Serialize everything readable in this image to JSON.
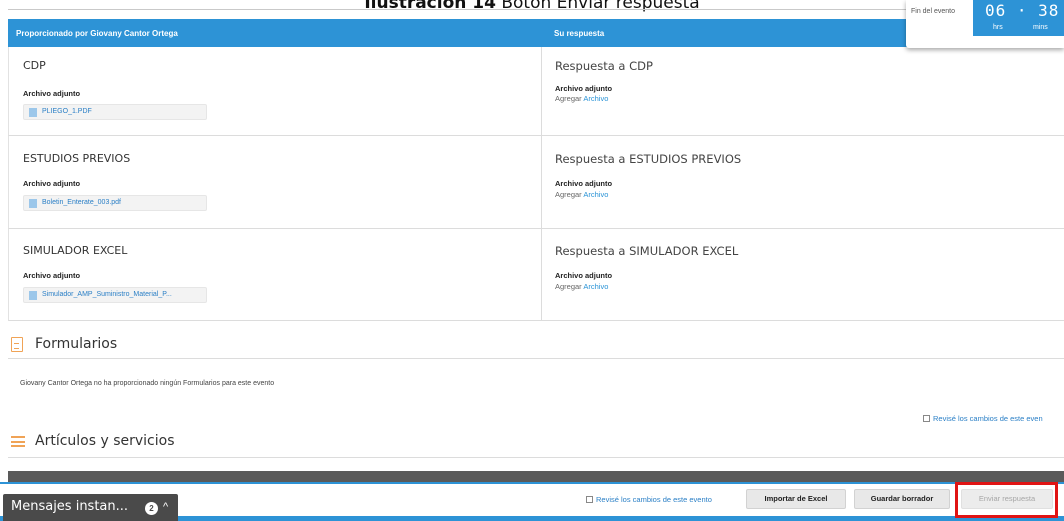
{
  "caption": {
    "bold": "Ilustración 14",
    "rest": " Botón Enviar respuesta"
  },
  "timer": {
    "label": "Fin del evento",
    "digits": "06 · 38",
    "hrs": "hrs",
    "mins": "mins"
  },
  "table_header": {
    "left": "Proporcionado por Giovany Cantor Ortega",
    "right": "Su respuesta"
  },
  "documents": [
    {
      "title": "CDP",
      "attach_label": "Archivo adjunto",
      "file": "PLIEGO_1.PDF",
      "response_title": "Respuesta a CDP",
      "response_attach_label": "Archivo adjunto",
      "add_label": "Agregar",
      "add_link": "Archivo"
    },
    {
      "title": "ESTUDIOS PREVIOS",
      "attach_label": "Archivo adjunto",
      "file": "Boletin_Enterate_003.pdf",
      "response_title": "Respuesta a ESTUDIOS PREVIOS",
      "response_attach_label": "Archivo adjunto",
      "add_label": "Agregar",
      "add_link": "Archivo"
    },
    {
      "title": "SIMULADOR EXCEL",
      "attach_label": "Archivo adjunto",
      "file": "Simulador_AMP_Suministro_Material_P...",
      "response_title": "Respuesta a SIMULADOR EXCEL",
      "response_attach_label": "Archivo adjunto",
      "add_label": "Agregar",
      "add_link": "Archivo"
    }
  ],
  "forms": {
    "title": "Formularios",
    "empty_note": "Giovany Cantor Ortega no ha proporcionado ningún Formularios para este evento"
  },
  "review_top": "Revisé los cambios de este even",
  "items": {
    "title": "Artículos y servicios"
  },
  "footer": {
    "review_label": "Revisé los cambios de este evento",
    "import_button": "Importar de Excel",
    "save_button": "Guardar borrador",
    "send_button": "Enviar respuesta"
  },
  "chat": {
    "label": "Mensajes instan...",
    "badge": "2",
    "chevron": "^"
  },
  "colors": {
    "accent": "#2d93d6",
    "highlight": "#e01414",
    "icon_orange": "#f0a356"
  }
}
